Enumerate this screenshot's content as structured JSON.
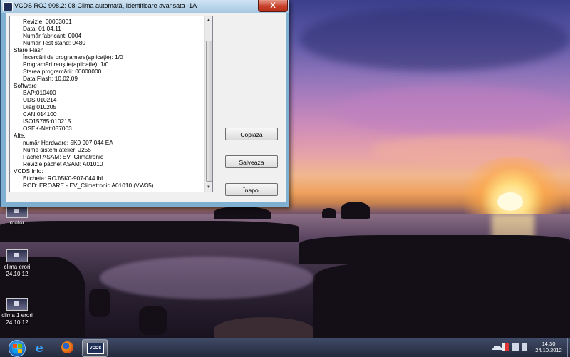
{
  "window": {
    "title": "VCDS ROJ 908.2: 08-Clima automată,  Identificare avansata -1A-",
    "close_glyph": "X",
    "list_lines": [
      {
        "text": "Revizie: 00003001",
        "indent": true
      },
      {
        "text": "Data: 01.04.11",
        "indent": true
      },
      {
        "text": "Număr fabricant: 0004",
        "indent": true
      },
      {
        "text": "Număr Test stand: 0480",
        "indent": true
      },
      {
        "text": "Stare Flash",
        "indent": false
      },
      {
        "text": "Încercări de programare(aplicație): 1/0",
        "indent": true
      },
      {
        "text": "Programări reușite(aplicație): 1/0",
        "indent": true
      },
      {
        "text": "Starea programării: 00000000",
        "indent": true
      },
      {
        "text": "Data Flash: 10.02.09",
        "indent": true
      },
      {
        "text": "Software",
        "indent": false
      },
      {
        "text": "BAP:010400",
        "indent": true
      },
      {
        "text": "UDS:010214",
        "indent": true
      },
      {
        "text": "Diag:010205",
        "indent": true
      },
      {
        "text": "CAN:014100",
        "indent": true
      },
      {
        "text": "ISO15765:010215",
        "indent": true
      },
      {
        "text": "OSEK-Net:037003",
        "indent": true
      },
      {
        "text": "Alte.",
        "indent": false
      },
      {
        "text": "număr Hardware: 5K0 907 044 EA",
        "indent": true
      },
      {
        "text": "Nume sistem atelier: J255",
        "indent": true
      },
      {
        "text": "Pachet ASAM: EV_Climatronic",
        "indent": true
      },
      {
        "text": "Revizie pachet ASAM: A01010",
        "indent": true
      },
      {
        "text": "VCDS Info:",
        "indent": false
      },
      {
        "text": "Eticheta: ROJ\\5K0-907-044.lbl",
        "indent": true
      },
      {
        "text": "ROD: EROARE - EV_Climatronic A01010 (VW35)",
        "indent": true
      }
    ],
    "buttons": {
      "copy": "Copiaza",
      "save": "Salveaza",
      "back": "Înapoi"
    }
  },
  "desktop_icons": [
    {
      "name": "motor",
      "line1": "motor",
      "line2": ""
    },
    {
      "name": "clima-erori",
      "line1": "clima erori",
      "line2": "24.10.12"
    },
    {
      "name": "clima-1-erori",
      "line1": "clima 1 erori",
      "line2": "24.10.12"
    }
  ],
  "taskbar": {
    "apps": [
      "internet-explorer-icon",
      "firefox-icon",
      "vcds-icon"
    ],
    "vcds_label": "VCDS",
    "time": "14:30",
    "date": "24.10.2012"
  }
}
